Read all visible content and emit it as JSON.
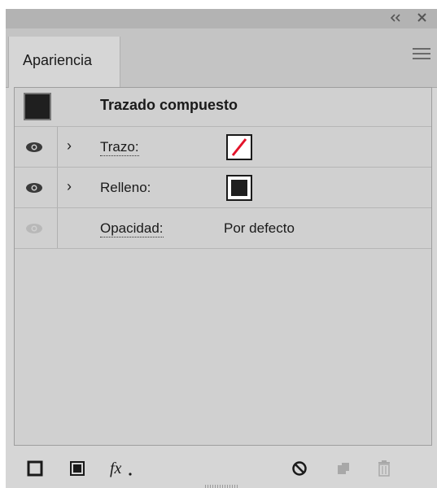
{
  "panel": {
    "tab_label": "Apariencia"
  },
  "object": {
    "title": "Trazado compuesto"
  },
  "rows": [
    {
      "label": "Trazo:",
      "swatch": "stroke-none"
    },
    {
      "label": "Relleno:",
      "swatch": "fill-black"
    },
    {
      "label": "Opacidad:",
      "value": "Por defecto"
    }
  ],
  "icons": {
    "collapse": "double-chevron-left-icon",
    "close": "close-icon",
    "menu": "hamburger-menu-icon",
    "visibility": "eye-icon",
    "expand": "chevron-right-icon",
    "add_stroke": "new-stroke-icon",
    "add_fill": "new-fill-icon",
    "effects": "fx-icon",
    "clear": "clear-appearance-icon",
    "duplicate": "duplicate-item-icon",
    "delete": "trash-icon"
  },
  "colors": {
    "accent_red": "#e3132a",
    "swatch_black": "#1f1f1f"
  }
}
